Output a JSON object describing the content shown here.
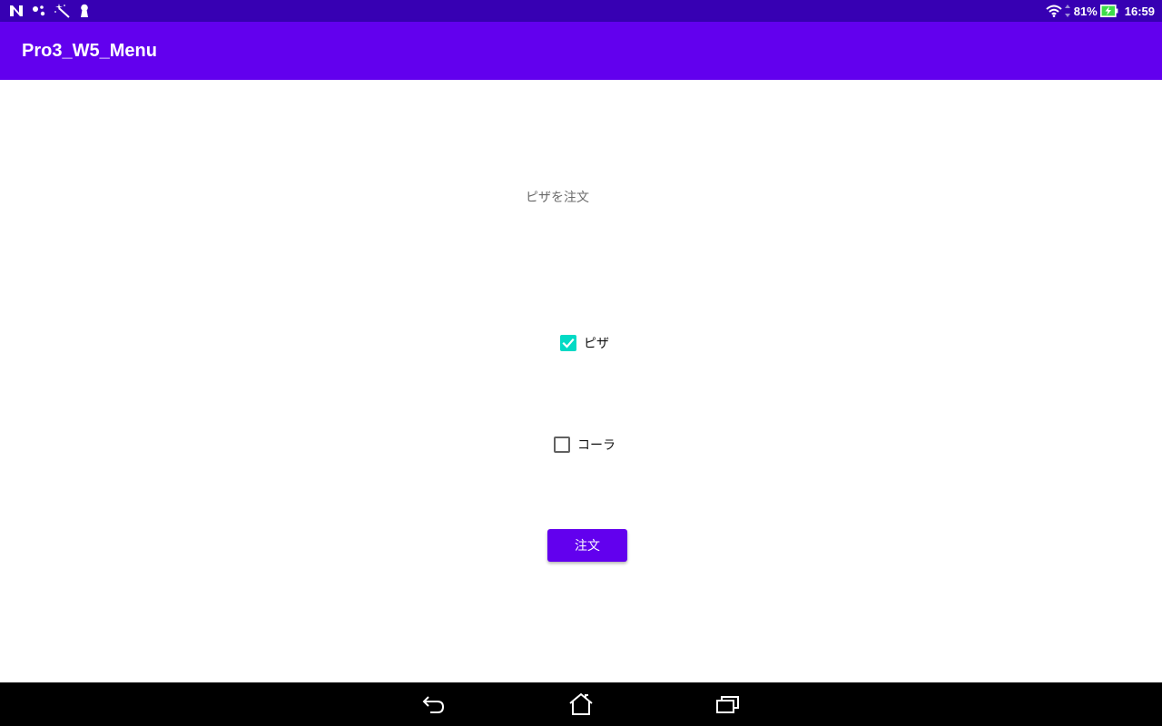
{
  "status_bar": {
    "left_icons": [
      "n-notification-icon",
      "assistant-dots-icon",
      "magic-wand-icon",
      "keyhole-icon"
    ],
    "battery": "81%",
    "time": "16:59",
    "right_icons": [
      "wifi-icon",
      "data-arrows-icon",
      "battery-charging-icon"
    ]
  },
  "app_bar": {
    "title": "Pro3_W5_Menu"
  },
  "main": {
    "heading": "ピザを注文",
    "options": [
      {
        "label": "ピザ",
        "checked": true
      },
      {
        "label": "コーラ",
        "checked": false
      }
    ],
    "order_button": "注文"
  },
  "nav_bar": {
    "buttons": [
      "back-icon",
      "home-icon",
      "recents-icon"
    ]
  },
  "colors": {
    "status_bar": "#3700b3",
    "primary": "#6200ee",
    "checkbox_accent": "#03dac5",
    "nav_bar": "#000000"
  }
}
